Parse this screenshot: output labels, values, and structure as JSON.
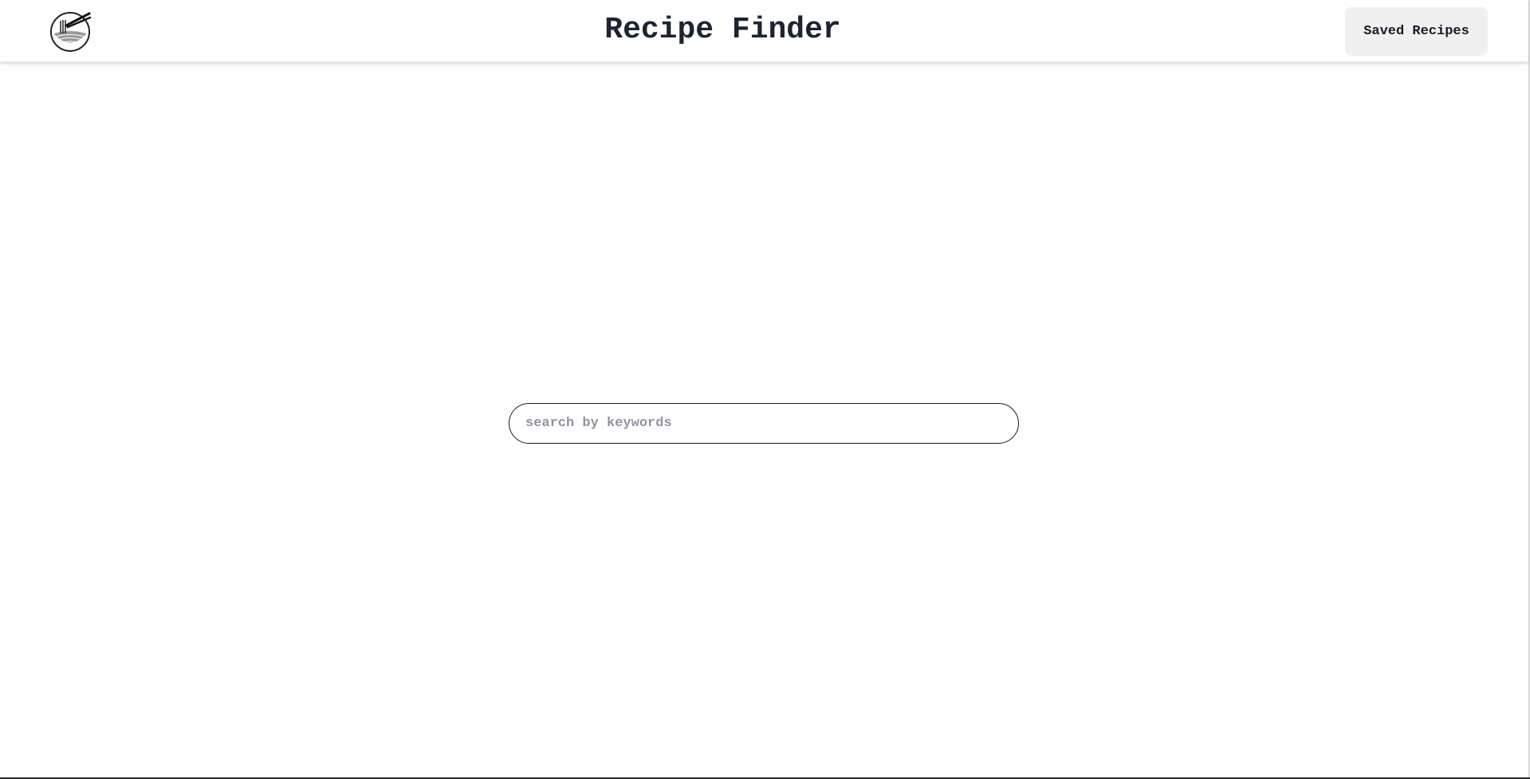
{
  "header": {
    "title": "Recipe Finder",
    "saved_button_label": "Saved Recipes",
    "logo_icon": "noodle-bowl-logo-icon"
  },
  "search": {
    "placeholder": "search by keywords",
    "value": ""
  },
  "colors": {
    "title_text": "#1c2433",
    "button_background": "#f0f0f0",
    "placeholder_text": "#8f94a0",
    "search_border": "#1a1a1a"
  }
}
